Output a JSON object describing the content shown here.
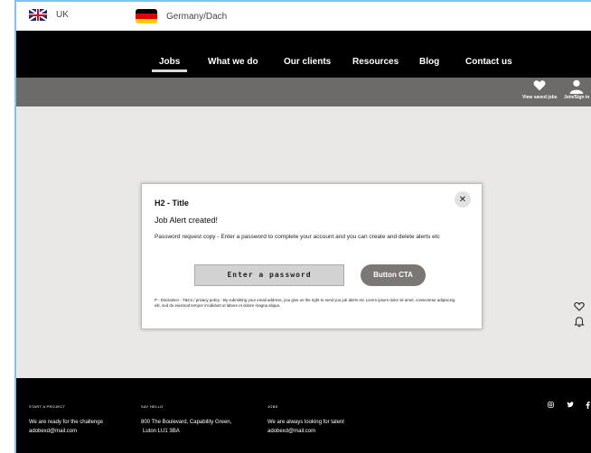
{
  "locale_bar": {
    "uk_label": "UK",
    "de_label": "Germany/Dach"
  },
  "nav": {
    "items": [
      "Jobs",
      "What we do",
      "Our clients",
      "Resources",
      "Blog",
      "Contact us"
    ]
  },
  "userbar": {
    "saved_jobs_label": "View saved jobs",
    "join_label": "Join/Sign in"
  },
  "modal": {
    "title": "H2 - Title",
    "subtitle": "Job Alert created!",
    "body": "Password request copy - Enter a password to complete your account and you can create and delete alerts etc",
    "password_placeholder": "Enter a password",
    "cta_label": "Button CTA",
    "disclaimer": "P - Disclaimer - T&Cs / privacy policy - By submitting your email address, you give us the right to send you job alerts etc Lorem ipsum dolor sit amet, consectetur adipiscing elit, sed do eiusmod tempor incididunt ut labore et dolore magna aliqua.",
    "close_glyph": "✕"
  },
  "footer": {
    "col1": {
      "heading": "START A PROJECT",
      "line1": "We are ready for the challenge",
      "line2": "adobexd@mail.com"
    },
    "col2": {
      "heading": "SAY HELLO",
      "line1": "800 The Boulevard, Capability Green,",
      "line2": "Luton LU1 3BA"
    },
    "col3": {
      "heading": "JOBS",
      "line1": "We are always looking for talent",
      "line2": "adobexd@mail.com"
    },
    "social": [
      "instagram-icon",
      "twitter-icon",
      "facebook-icon"
    ]
  },
  "colors": {
    "nav_bg": "#000000",
    "userbar_bg": "#6d6b69",
    "page_bg": "#e9e8e6",
    "cta_bg": "#7a7774",
    "input_bg": "#d2d2d2"
  }
}
